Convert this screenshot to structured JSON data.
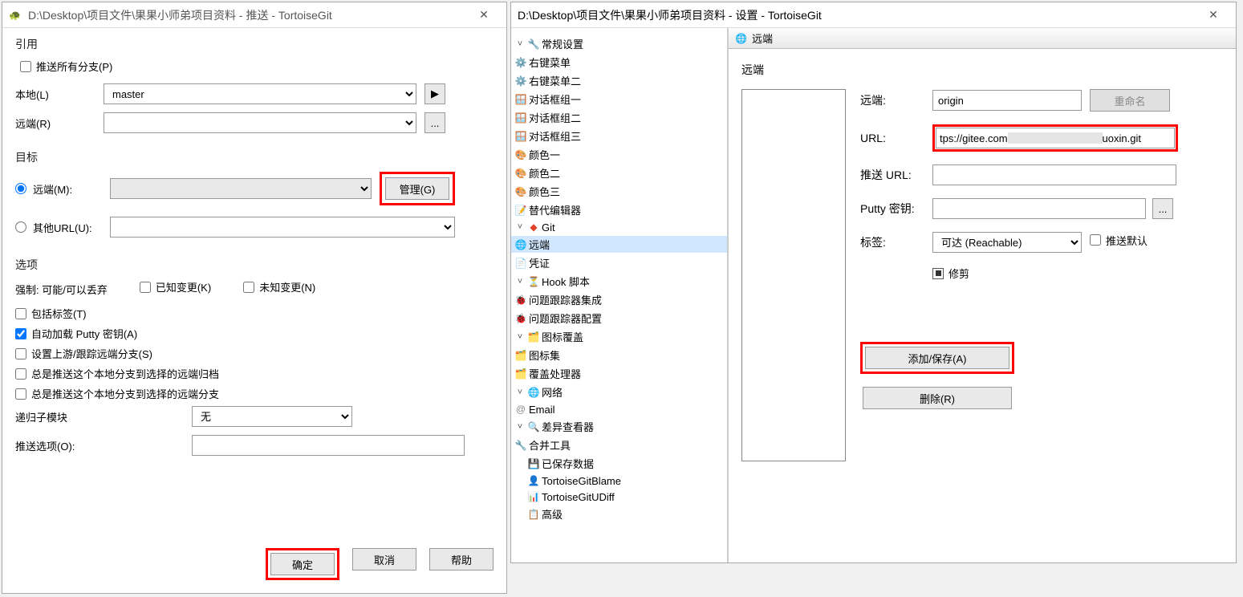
{
  "left": {
    "title": "D:\\Desktop\\项目文件\\果果小师弟项目资料 - 推送 - TortoiseGit",
    "close": "✕",
    "g_ref": "引用",
    "push_all": "推送所有分支(P)",
    "local_label": "本地(L)",
    "local_value": "master",
    "remote_ref_label": "远端(R)",
    "remote_ref_value": "",
    "browse": "...",
    "play": "▶",
    "g_target": "目标",
    "remote_radio": "远端(M):",
    "remote_combo_value": "",
    "manage_btn": "管理(G)",
    "other_url_radio": "其他URL(U):",
    "other_url_value": "",
    "g_options": "选项",
    "force_text": "强制:  可能/可以丢弃",
    "known_change": "已知变更(K)",
    "unknown_change": "未知变更(N)",
    "include_tags": "包括标签(T)",
    "autoload_putty": "自动加载 Putty 密钥(A)",
    "set_upstream": "设置上游/跟踪远端分支(S)",
    "always_push_archive": "总是推送这个本地分支到选择的远端归档",
    "always_push_branch": "总是推送这个本地分支到选择的远端分支",
    "recurse_label": "递归子模块",
    "recurse_value": "无",
    "push_opt_label": "推送选项(O):",
    "push_opt_value": "",
    "ok": "确定",
    "cancel": "取消",
    "help": "帮助"
  },
  "right": {
    "title": "D:\\Desktop\\项目文件\\果果小师弟项目资料 - 设置 - TortoiseGit",
    "close": "✕",
    "tree": {
      "general": "常规设置",
      "context1": "右键菜单",
      "context2": "右键菜单二",
      "dlg1": "对话框组一",
      "dlg2": "对话框组二",
      "dlg3": "对话框组三",
      "color1": "颜色一",
      "color2": "颜色二",
      "color3": "颜色三",
      "alt_editor": "替代编辑器",
      "git": "Git",
      "remote": "远端",
      "cred": "凭证",
      "hook": "Hook 脚本",
      "issue_int": "问题跟踪器集成",
      "issue_cfg": "问题跟踪器配置",
      "overlay": "图标覆盖",
      "iconset": "图标集",
      "overlay_handler": "覆盖处理器",
      "network": "网络",
      "email": "Email",
      "diffviewer": "差异查看器",
      "mergetool": "合并工具",
      "saved": "已保存数据",
      "blame": "TortoiseGitBlame",
      "udiff": "TortoiseGitUDiff",
      "advanced": "高级"
    },
    "panel_title": "远端",
    "section_title": "远端",
    "f_remote": "远端:",
    "remote_value": "origin",
    "rename": "重命名",
    "f_url": "URL:",
    "url_prefix": "tps://gitee.com",
    "url_suffix": "uoxin.git",
    "f_push_url": "推送 URL:",
    "push_url_value": "",
    "f_putty": "Putty 密钥:",
    "putty_value": "",
    "putty_browse": "...",
    "f_tags": "标签:",
    "tags_value": "可达 (Reachable)",
    "push_default": "推送默认",
    "prune": "修剪",
    "add_save": "添加/保存(A)",
    "delete": "删除(R)"
  }
}
